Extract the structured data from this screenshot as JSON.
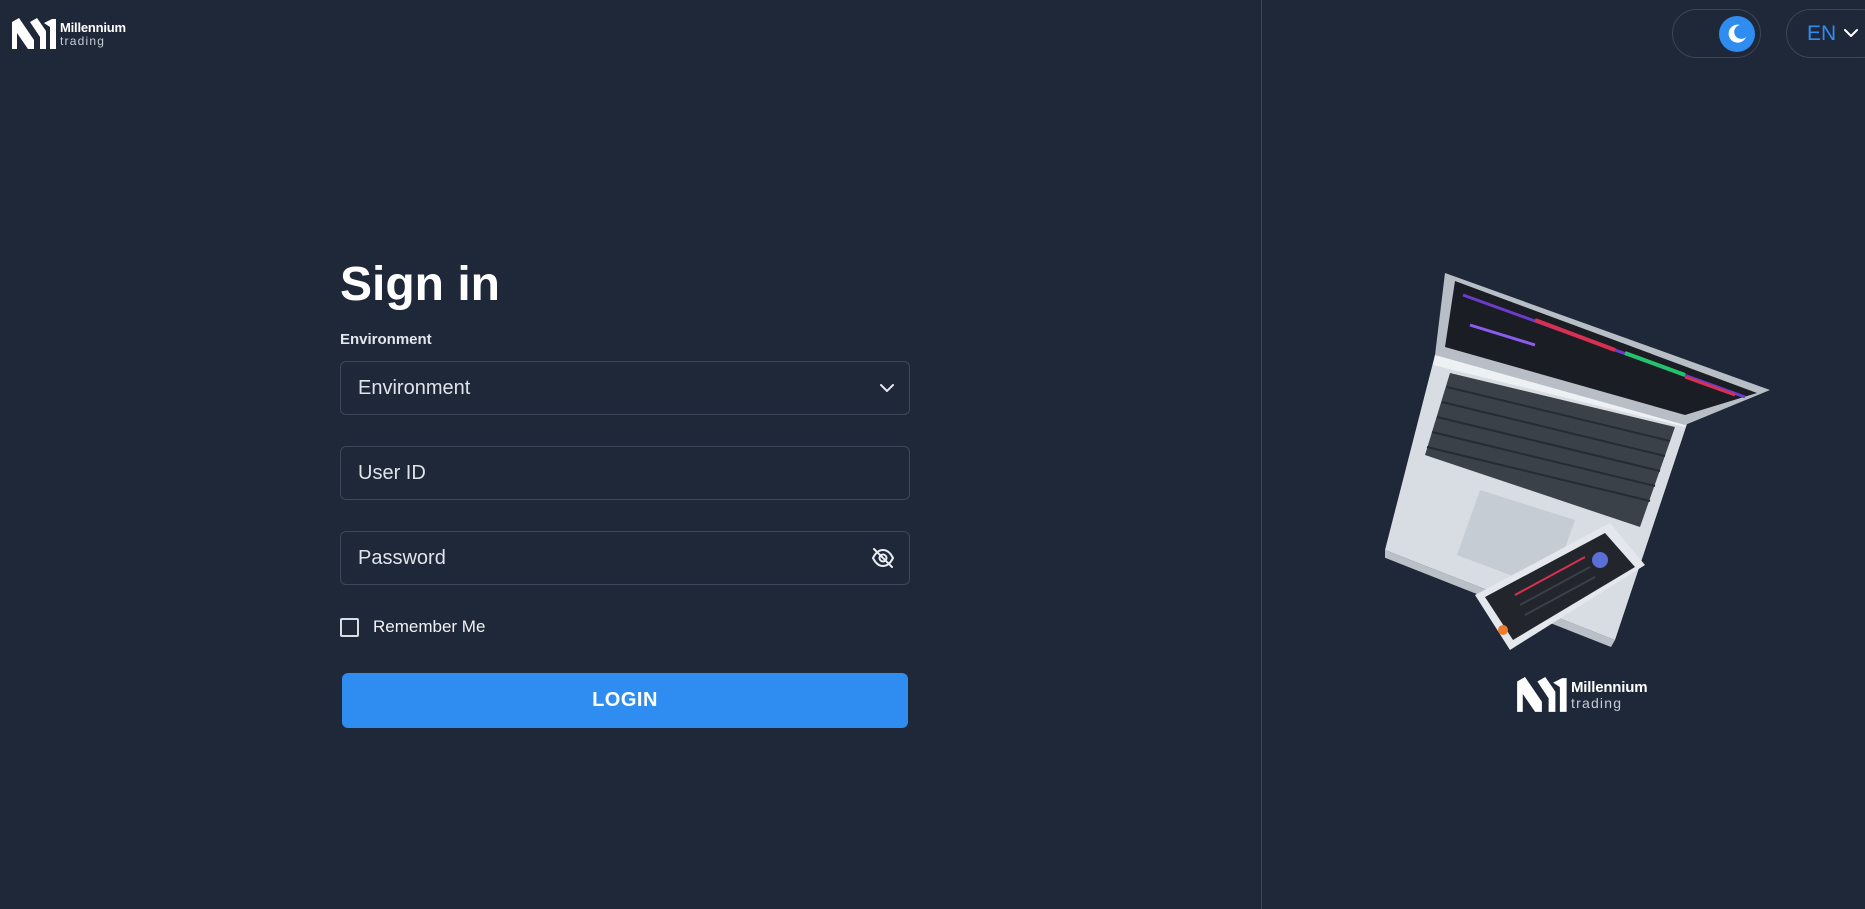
{
  "brand": {
    "name_line1": "Millennium",
    "name_line2": "trading",
    "icon": "millennium-logo-icon"
  },
  "header": {
    "theme_toggle": {
      "mode": "dark",
      "icon": "moon-icon"
    },
    "language": {
      "selected": "EN",
      "icon": "chevron-down-icon"
    }
  },
  "form": {
    "title": "Sign in",
    "environment_label": "Environment",
    "environment_placeholder": "Environment",
    "user_id_placeholder": "User ID",
    "password_placeholder": "Password",
    "password_toggle_icon": "eye-off-icon",
    "remember_me": {
      "label": "Remember Me",
      "checked": false
    },
    "login_label": "LOGIN"
  },
  "colors": {
    "background": "#1f2839",
    "accent": "#2f8cf0",
    "border": "#3d4759"
  },
  "illustration": {
    "icon": "laptop-and-phone-illustration"
  }
}
